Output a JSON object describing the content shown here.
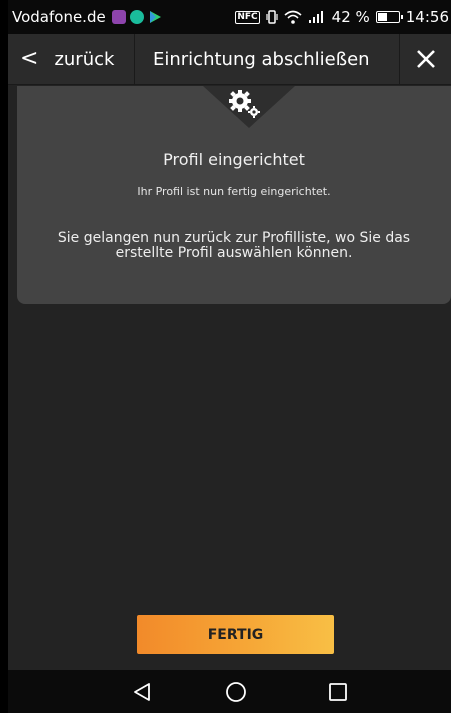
{
  "status_bar": {
    "carrier": "Vodafone.de",
    "nfc": "NFC",
    "battery_percent": "42 %",
    "time": "14:56",
    "app_icon_colors": [
      "#8e44ad",
      "#1abc9c",
      "#2ecc71"
    ]
  },
  "header": {
    "back_label": "zurück",
    "title": "Einrichtung abschließen"
  },
  "card": {
    "icon": "gear-icon",
    "title": "Profil eingerichtet",
    "subtitle": "Ihr Profil ist nun fertig eingerichtet.",
    "body": "Sie gelangen nun zurück zur Profilliste, wo Sie das erstellte Profil auswählen können."
  },
  "button": {
    "label": "FERTIG"
  },
  "colors": {
    "accent_start": "#f28a2a",
    "accent_end": "#f8bf45",
    "background": "#232323",
    "card": "#444444"
  },
  "nav": {
    "back_icon": "triangle-back-icon",
    "home_icon": "circle-home-icon",
    "recents_icon": "square-recents-icon"
  }
}
